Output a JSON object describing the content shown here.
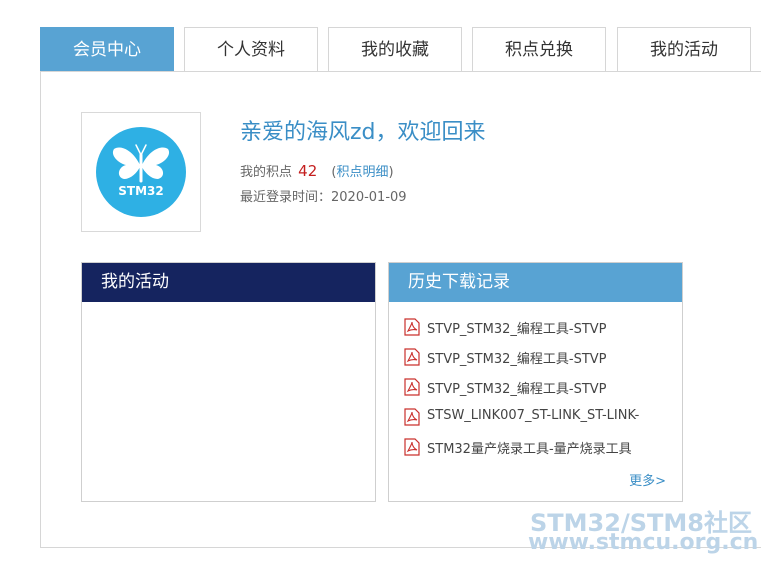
{
  "tabs": [
    {
      "label": "会员中心",
      "active": true
    },
    {
      "label": "个人资料",
      "active": false
    },
    {
      "label": "我的收藏",
      "active": false
    },
    {
      "label": "积点兑换",
      "active": false
    },
    {
      "label": "我的活动",
      "active": false
    }
  ],
  "profile": {
    "avatar_text": "STM32",
    "welcome": "亲爱的海风zd，欢迎回来",
    "points_label": "我的积点",
    "points_value": "42",
    "points_link": "积点明细",
    "last_login_label": "最近登录时间：",
    "last_login_value": "2020-01-09"
  },
  "activity_box": {
    "title": "我的活动"
  },
  "history_box": {
    "title": "历史下载记录",
    "items": [
      "STVP_STM32_编程工具-STVP",
      "STVP_STM32_编程工具-STVP",
      "STVP_STM32_编程工具-STVP",
      "STSW_LINK007_ST-LINK_ST-LINK-",
      "STM32量产烧录工具-量产烧录工具"
    ],
    "more": "更多>"
  },
  "watermark": {
    "line1": "STM32/STM8社区",
    "line2": "www.stmcu.org.cn"
  },
  "colors": {
    "tab_active": "#58a3d3",
    "activity_header": "#15245f",
    "history_header": "#58a3d3",
    "link": "#3a8ec6",
    "points": "#c41e1e",
    "avatar_bg": "#2eb0e4"
  }
}
